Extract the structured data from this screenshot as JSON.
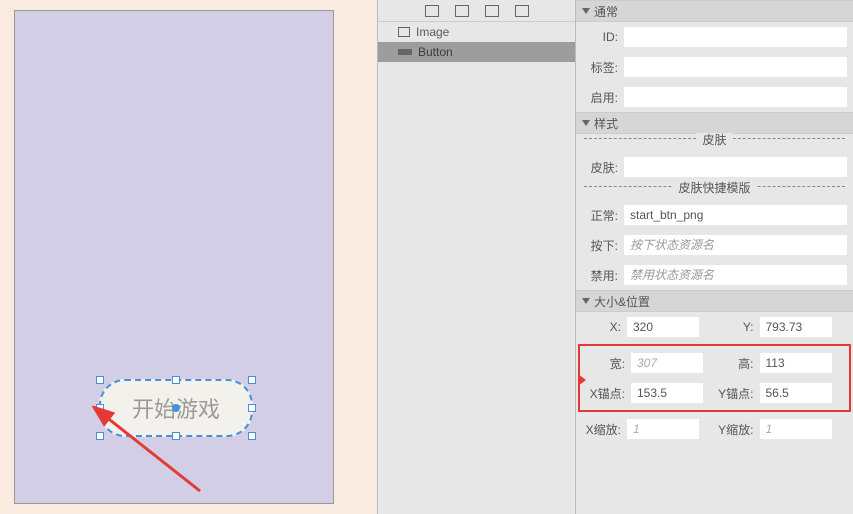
{
  "canvas": {
    "button_text": "开始游戏"
  },
  "hierarchy": {
    "items": [
      {
        "label": "Image"
      },
      {
        "label": "Button"
      }
    ]
  },
  "props": {
    "section_common": "通常",
    "id_label": "ID:",
    "id_value": "",
    "tag_label": "标签:",
    "tag_value": "",
    "enable_label": "启用:",
    "enable_value": "",
    "section_style": "样式",
    "skin_divider": "皮肤",
    "skin_label": "皮肤:",
    "skin_value": "",
    "skin_tpl_divider": "皮肤快捷模版",
    "normal_label": "正常:",
    "normal_value": "start_btn_png",
    "press_label": "按下:",
    "press_placeholder": "按下状态资源名",
    "disable_label": "禁用:",
    "disable_placeholder": "禁用状态资源名",
    "section_size": "大小&位置",
    "x_label": "X:",
    "x_value": "320",
    "y_label": "Y:",
    "y_value": "793.73",
    "w_label": "宽:",
    "w_value": "307",
    "h_label": "高:",
    "h_value": "113",
    "ax_label": "X锚点:",
    "ax_value": "153.5",
    "ay_label": "Y锚点:",
    "ay_value": "56.5",
    "sx_label": "X缩放:",
    "sx_value": "1",
    "sy_label": "Y缩放:",
    "sy_value": "1"
  }
}
